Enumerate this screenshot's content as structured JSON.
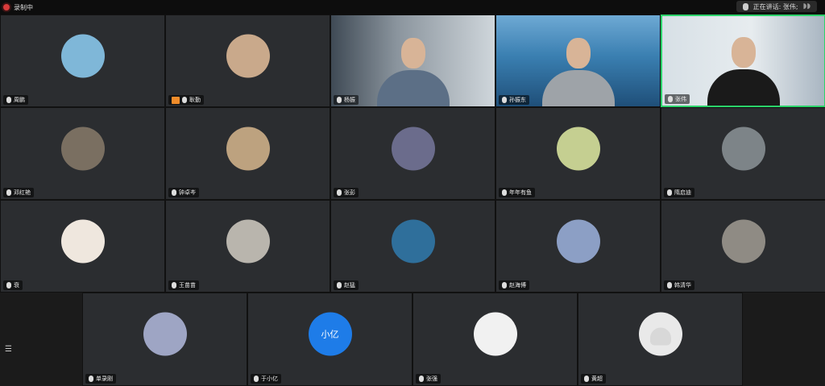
{
  "top": {
    "recording_label": "录制中",
    "speaking_label": "正在讲话: 张伟;"
  },
  "tiles": [
    {
      "name": "周鹏",
      "type": "avatar",
      "color": "#7fb7d8",
      "highlight": false
    },
    {
      "name": "耿勤",
      "type": "avatar",
      "color": "#c9a98b",
      "highlight": false,
      "share": true
    },
    {
      "name": "杨振",
      "type": "video",
      "color": "#6b7683",
      "highlight": false
    },
    {
      "name": "孙振东",
      "type": "video",
      "color": "#2d6a92",
      "highlight": false
    },
    {
      "name": "张伟",
      "type": "video",
      "color": "#c9d5db",
      "highlight": true
    },
    {
      "name": "邓红艳",
      "type": "avatar",
      "color": "#7a6f61",
      "highlight": false
    },
    {
      "name": "钟卓岑",
      "type": "avatar",
      "color": "#bda27f",
      "highlight": false
    },
    {
      "name": "张彭",
      "type": "avatar",
      "color": "#6b6c8c",
      "highlight": false
    },
    {
      "name": "年年有鱼",
      "type": "avatar",
      "color": "#c5cf91",
      "highlight": false
    },
    {
      "name": "隋启迪",
      "type": "avatar",
      "color": "#7d8488",
      "highlight": false
    },
    {
      "name": "衰",
      "type": "avatar",
      "color": "#efe7de",
      "highlight": false
    },
    {
      "name": "王苗苗",
      "type": "avatar",
      "color": "#b9b5ad",
      "highlight": false
    },
    {
      "name": "赵猛",
      "type": "avatar",
      "color": "#2f6f9b",
      "highlight": false
    },
    {
      "name": "赵海博",
      "type": "avatar",
      "color": "#8c9fc5",
      "highlight": false
    },
    {
      "name": "韩清华",
      "type": "avatar",
      "color": "#8f8b84",
      "highlight": false
    },
    {
      "name": "单录刚",
      "type": "avatar",
      "color": "#9ea5c4",
      "highlight": false
    },
    {
      "name": "于小亿",
      "type": "initial",
      "initial": "小亿",
      "color": "#1e7ce8",
      "highlight": false
    },
    {
      "name": "张强",
      "type": "avatar",
      "color": "#f1f1f1",
      "highlight": false
    },
    {
      "name": "黄超",
      "type": "avatar",
      "color": "#e9e9e9",
      "highlight": false
    }
  ],
  "sidebar_icon": "list-icon",
  "sidebar_glyph": "☰"
}
